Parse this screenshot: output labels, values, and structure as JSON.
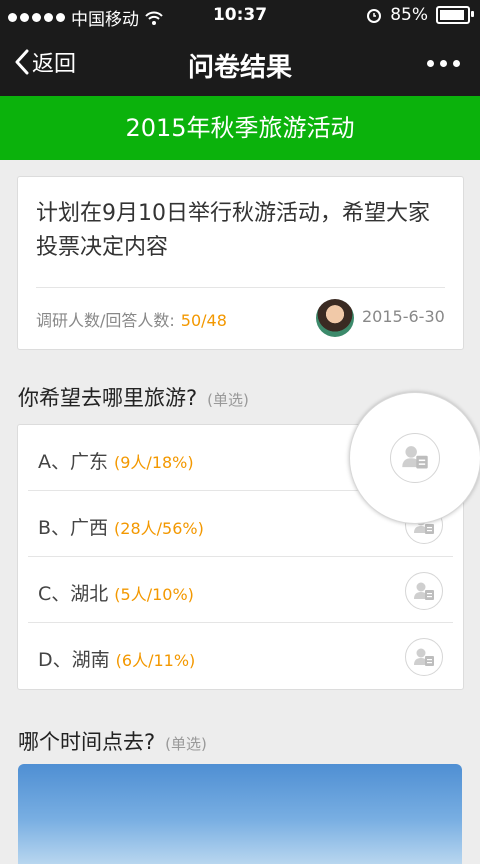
{
  "status_bar": {
    "carrier": "中国移动",
    "time": "10:37",
    "battery": "85%",
    "battery_level": 0.85
  },
  "nav": {
    "back_label": "返回",
    "title": "问卷结果"
  },
  "banner": {
    "title": "2015年秋季旅游活动"
  },
  "survey": {
    "description": "计划在9月10日举行秋游活动，希望大家投票决定内容",
    "stats_label": "调研人数/回答人数:",
    "stats_value": "50/48",
    "date": "2015-6-30"
  },
  "question1": {
    "title": "你希望去哪里旅游?",
    "type": "(单选)",
    "options": [
      {
        "label": "A、广东",
        "detail": "(9人/18%)"
      },
      {
        "label": "B、广西",
        "detail": "(28人/56%)"
      },
      {
        "label": "C、湖北",
        "detail": "(5人/10%)"
      },
      {
        "label": "D、湖南",
        "detail": "(6人/11%)"
      }
    ]
  },
  "question2": {
    "title": "哪个时间点去?",
    "type": "(单选)"
  },
  "colors": {
    "accent_green": "#0bb20c",
    "highlight_orange": "#f39800",
    "nav_bg": "#1b1b1b"
  }
}
